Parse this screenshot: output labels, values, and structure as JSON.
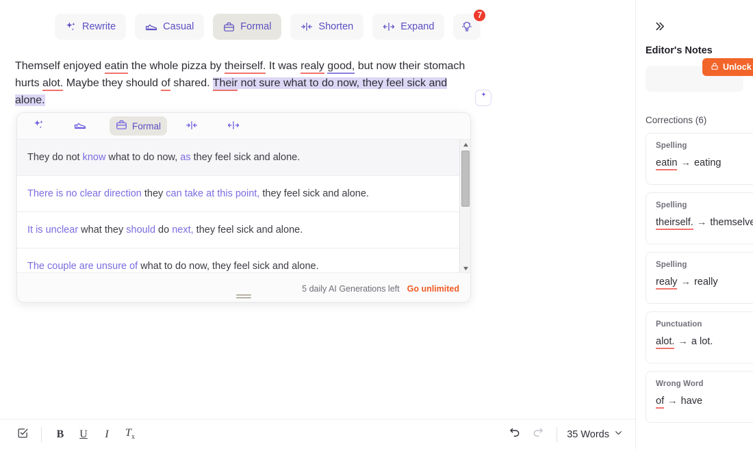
{
  "ai_toolbar": {
    "buttons": [
      {
        "label": "Rewrite",
        "icon": "sparkles-icon",
        "active": false
      },
      {
        "label": "Casual",
        "icon": "sneaker-icon",
        "active": false
      },
      {
        "label": "Formal",
        "icon": "briefcase-icon",
        "active": true
      },
      {
        "label": "Shorten",
        "icon": "shorten-icon",
        "active": false
      },
      {
        "label": "Expand",
        "icon": "expand-icon",
        "active": false
      }
    ],
    "ideas_button": {
      "icon": "lightbulb-icon",
      "badge": "7"
    }
  },
  "document": {
    "segments": [
      {
        "text": "Themself enjoyed ",
        "style": "plain"
      },
      {
        "text": "eatin",
        "style": "error-red"
      },
      {
        "text": " the whole pizza by ",
        "style": "plain"
      },
      {
        "text": "theirself.",
        "style": "error-red"
      },
      {
        "text": " It was ",
        "style": "plain"
      },
      {
        "text": "realy",
        "style": "error-red"
      },
      {
        "text": " ",
        "style": "plain"
      },
      {
        "text": "good,",
        "style": "error-blue"
      },
      {
        "text": " but now their stomach hurts ",
        "style": "plain"
      },
      {
        "text": "alot.",
        "style": "error-red"
      },
      {
        "text": " Maybe they should ",
        "style": "plain"
      },
      {
        "text": "of",
        "style": "error-red"
      },
      {
        "text": " shared. ",
        "style": "plain"
      },
      {
        "text": "Their",
        "style": "selected-error-red"
      },
      {
        "text": " not sure what to do now, they feel sick and alone.",
        "style": "selected"
      }
    ],
    "full_text": "Themself enjoyed eatin the whole pizza by theirself. It was realy good, but now their stomach hurts alot. Maybe they should of shared. Their not sure what to do now, they feel sick and alone."
  },
  "floating_button": {
    "icon": "sparkle-icon"
  },
  "popup": {
    "toolbar": [
      {
        "label": "",
        "icon": "sparkles-icon",
        "active": false
      },
      {
        "label": "",
        "icon": "sneaker-icon",
        "active": false
      },
      {
        "label": "Formal",
        "icon": "briefcase-icon",
        "active": true
      },
      {
        "label": "",
        "icon": "shorten-icon",
        "active": false
      },
      {
        "label": "",
        "icon": "expand-icon",
        "active": false
      }
    ],
    "suggestions": [
      {
        "parts": [
          {
            "t": "They do not ",
            "hl": false
          },
          {
            "t": "know",
            "hl": true
          },
          {
            "t": " what to do now, ",
            "hl": false
          },
          {
            "t": "as",
            "hl": true
          },
          {
            "t": " they feel sick and alone.",
            "hl": false
          }
        ],
        "selected": true
      },
      {
        "parts": [
          {
            "t": "There is no clear direction",
            "hl": true
          },
          {
            "t": " they ",
            "hl": false
          },
          {
            "t": "can take at this point,",
            "hl": true
          },
          {
            "t": " they feel sick and alone.",
            "hl": false
          }
        ],
        "selected": false
      },
      {
        "parts": [
          {
            "t": "It is unclear",
            "hl": true
          },
          {
            "t": " what they ",
            "hl": false
          },
          {
            "t": "should",
            "hl": true
          },
          {
            "t": " do ",
            "hl": false
          },
          {
            "t": "next,",
            "hl": true
          },
          {
            "t": " they feel sick and alone.",
            "hl": false
          }
        ],
        "selected": false
      },
      {
        "parts": [
          {
            "t": "The couple are unsure of",
            "hl": true
          },
          {
            "t": " what to do now, they feel sick and alone.",
            "hl": false
          }
        ],
        "selected": false
      }
    ],
    "footer": {
      "generations_left": "5 daily AI Generations left",
      "upgrade_link": "Go unlimited"
    }
  },
  "bottom_bar": {
    "format_buttons": [
      {
        "label": "",
        "icon": "check-square-icon"
      },
      {
        "label": "B",
        "icon": "bold-icon"
      },
      {
        "label": "U",
        "icon": "underline-icon"
      },
      {
        "label": "I",
        "icon": "italic-icon"
      },
      {
        "label": "Tx",
        "icon": "clear-format-icon"
      }
    ],
    "undo_icon": "undo-icon",
    "redo_icon": "redo-icon",
    "word_count": "35 Words",
    "word_count_chevron": "chevron-down-icon"
  },
  "sidebar": {
    "collapse_icon": "chevron-double-right-icon",
    "title": "Editor's Notes",
    "promo": {
      "label": "Unlock",
      "icon": "lock-icon"
    },
    "corrections_heading": "Corrections (6)",
    "corrections": [
      {
        "type": "Spelling",
        "wrong": "eatin",
        "right": "eating"
      },
      {
        "type": "Spelling",
        "wrong": "theirself.",
        "right": "themselves"
      },
      {
        "type": "Spelling",
        "wrong": "realy",
        "right": "really"
      },
      {
        "type": "Punctuation",
        "wrong": "alot.",
        "right": "a lot."
      },
      {
        "type": "Wrong Word",
        "wrong": "of",
        "right": "have"
      }
    ]
  },
  "colors": {
    "accent_purple": "#5b4ec2",
    "highlight_lavender": "#dcd7f5",
    "error_red": "#f0736b",
    "badge_red": "#ef3b2d",
    "promo_orange": "#f2652a",
    "link_orange": "#f05a22"
  }
}
